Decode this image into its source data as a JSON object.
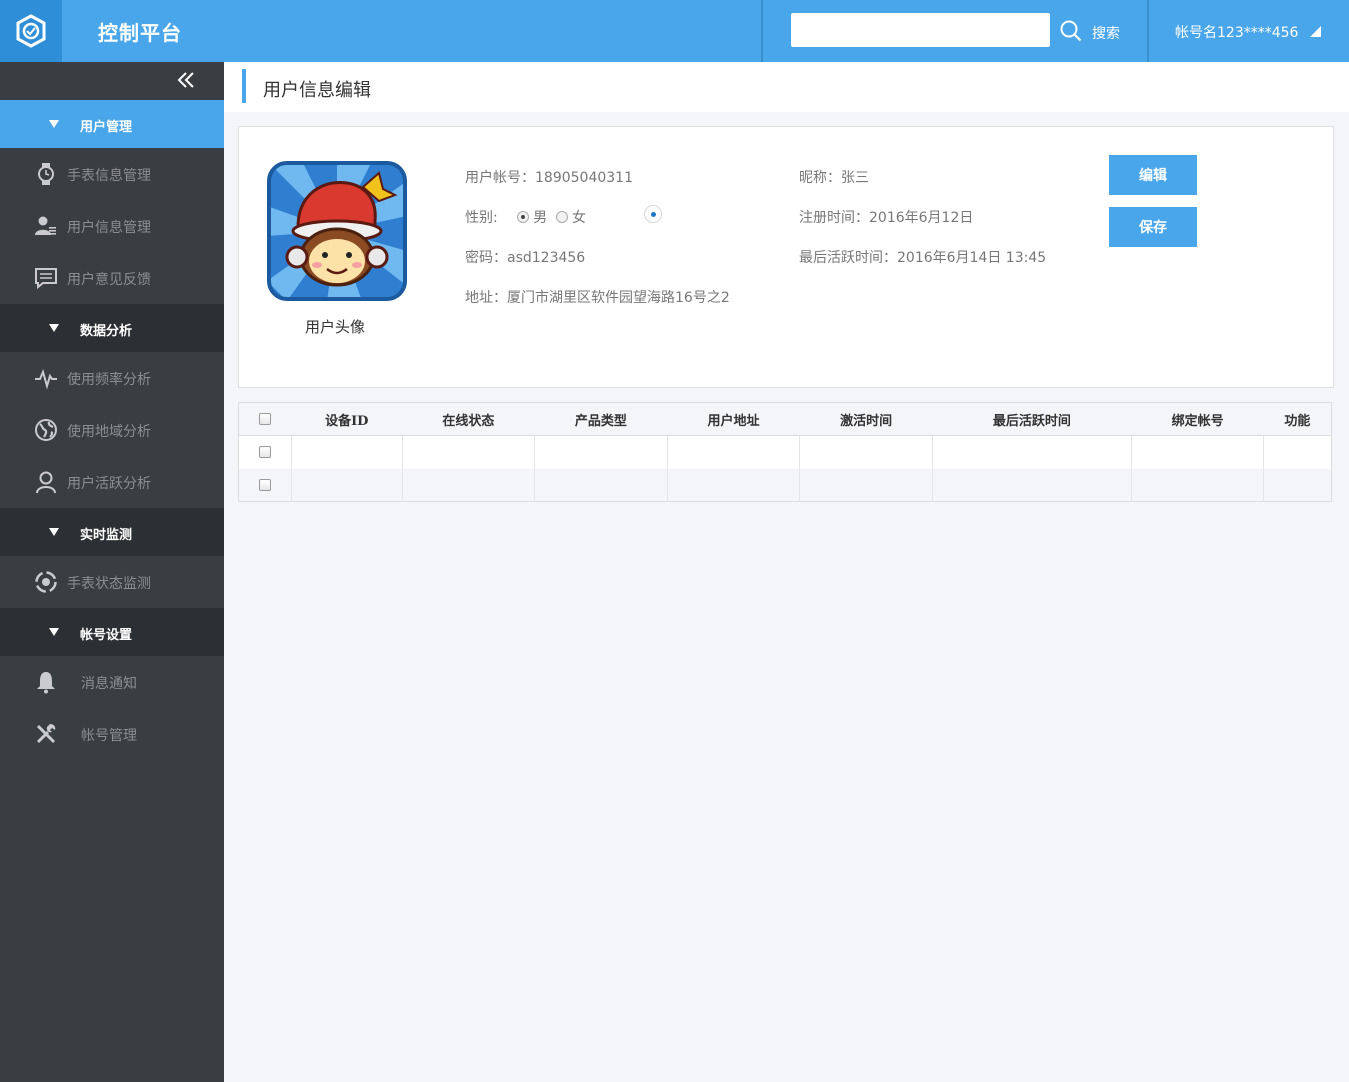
{
  "header": {
    "app_title": "控制平台",
    "search_placeholder": "",
    "search_label": "搜索",
    "account_name": "帐号名123****456"
  },
  "sidebar": {
    "sections": [
      {
        "label": "用户管理",
        "active": true
      },
      {
        "label": "数据分析",
        "active": false
      },
      {
        "label": "实时监测",
        "active": false
      },
      {
        "label": "帐号设置",
        "active": false
      }
    ],
    "items": [
      {
        "label": "手表信息管理",
        "icon": "watch-icon"
      },
      {
        "label": "用户信息管理",
        "icon": "user-list-icon"
      },
      {
        "label": "用户意见反馈",
        "icon": "feedback-icon"
      },
      {
        "label": "使用频率分析",
        "icon": "pulse-icon"
      },
      {
        "label": "使用地域分析",
        "icon": "globe-icon"
      },
      {
        "label": "用户活跃分析",
        "icon": "user-icon"
      },
      {
        "label": "手表状态监测",
        "icon": "monitor-icon"
      },
      {
        "label": "消息通知",
        "icon": "bell-icon"
      },
      {
        "label": "帐号管理",
        "icon": "tools-icon"
      }
    ],
    "accent_color": "#4aa6ea"
  },
  "page": {
    "title": "用户信息编辑"
  },
  "profile": {
    "avatar_caption": "用户头像",
    "account": "用户帐号：18905040311",
    "gender_label": "性别:",
    "gender_male": "男",
    "gender_female": "女",
    "gender_selected": "男",
    "password": "密码：asd123456",
    "address": "地址：厦门市湖里区软件园望海路16号之2",
    "nickname": "昵称：张三",
    "register_time": "注册时间：2016年6月12日",
    "last_active": "最后活跃时间：2016年6月14日 13:45",
    "edit_button": "编辑",
    "save_button": "保存"
  },
  "table": {
    "columns": [
      "设备ID",
      "在线状态",
      "产品类型",
      "用户地址",
      "激活时间",
      "最后活跃时间",
      "绑定帐号",
      "功能"
    ],
    "rows": [
      [
        "",
        "",
        "",
        "",
        "",
        "",
        "",
        ""
      ],
      [
        "",
        "",
        "",
        "",
        "",
        "",
        "",
        ""
      ]
    ]
  }
}
